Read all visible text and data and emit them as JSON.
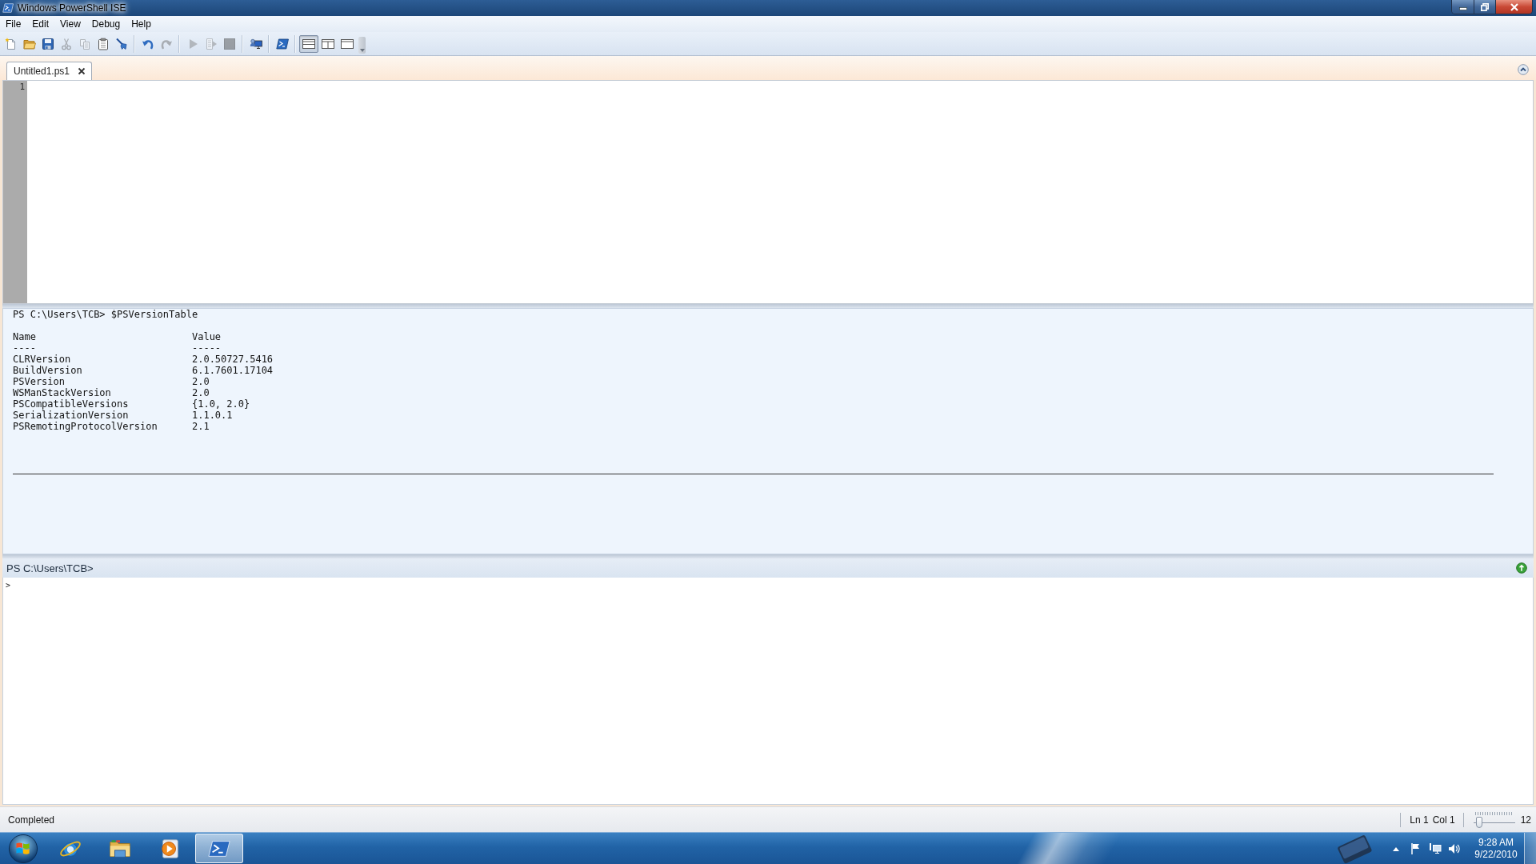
{
  "window": {
    "title": "Windows PowerShell ISE"
  },
  "menu": [
    "File",
    "Edit",
    "View",
    "Debug",
    "Help"
  ],
  "toolbar": [
    [
      {
        "kind": "new",
        "disabled": false
      },
      {
        "kind": "open",
        "disabled": false
      },
      {
        "kind": "save",
        "disabled": false
      },
      {
        "kind": "cut",
        "disabled": true
      },
      {
        "kind": "copy",
        "disabled": true
      },
      {
        "kind": "paste",
        "disabled": false
      },
      {
        "kind": "clear",
        "disabled": false
      }
    ],
    [
      {
        "kind": "undo",
        "disabled": false
      },
      {
        "kind": "redo",
        "disabled": true
      }
    ],
    [
      {
        "kind": "run",
        "disabled": true
      },
      {
        "kind": "run_selection",
        "disabled": true
      },
      {
        "kind": "stop",
        "disabled": true
      }
    ],
    [
      {
        "kind": "remote",
        "disabled": false
      }
    ],
    [
      {
        "kind": "console",
        "disabled": false
      }
    ]
  ],
  "layout_buttons": [
    {
      "kind": "top",
      "selected": true
    },
    {
      "kind": "right",
      "selected": false
    },
    {
      "kind": "maximized",
      "selected": false
    }
  ],
  "tabs": [
    {
      "label": "Untitled1.ps1",
      "selected": true
    }
  ],
  "editor": {
    "line_numbers": [
      "1"
    ]
  },
  "output": {
    "command": "PS C:\\Users\\TCB> $PSVersionTable",
    "columns": [
      "Name",
      "Value"
    ],
    "underlines": [
      "----",
      "-----"
    ],
    "rows": [
      [
        "CLRVersion",
        "2.0.50727.5416"
      ],
      [
        "BuildVersion",
        "6.1.7601.17104"
      ],
      [
        "PSVersion",
        "2.0"
      ],
      [
        "WSManStackVersion",
        "2.0"
      ],
      [
        "PSCompatibleVersions",
        "{1.0, 2.0}"
      ],
      [
        "SerializationVersion",
        "1.1.0.1"
      ],
      [
        "PSRemotingProtocolVersion",
        "2.1"
      ]
    ]
  },
  "command_pane": {
    "prompt": "PS C:\\Users\\TCB>",
    "input_marker": ">"
  },
  "status_bar": {
    "status": "Completed",
    "line": "Ln 1",
    "column": "Col 1",
    "zoom": {
      "level": 0.15,
      "reading": "12"
    }
  },
  "taskbar": {
    "apps": [
      {
        "kind": "browser",
        "selected": false
      },
      {
        "kind": "folder",
        "selected": false
      },
      {
        "kind": "media",
        "selected": false
      },
      {
        "kind": "console",
        "selected": true
      }
    ],
    "clock": {
      "time": "9:28 AM",
      "date": "9/22/2010"
    }
  }
}
